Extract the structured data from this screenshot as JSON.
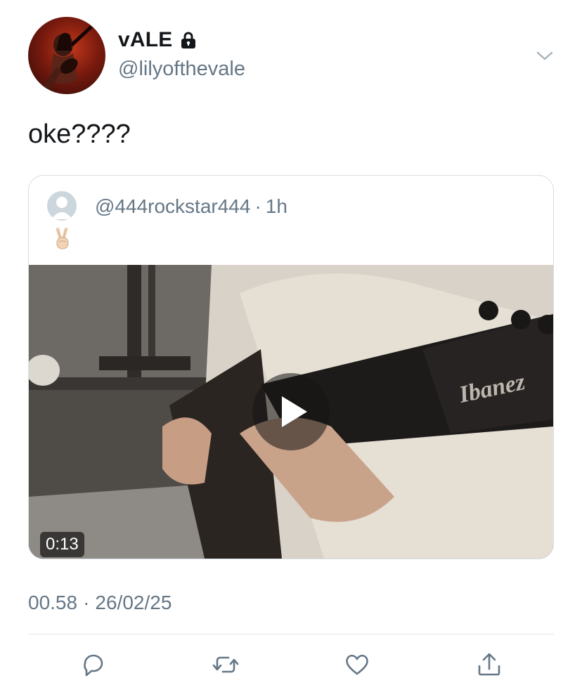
{
  "author": {
    "display_name": "vALE",
    "handle": "@lilyofthevale"
  },
  "tweet": {
    "text": "oke????"
  },
  "quoted_tweet": {
    "handle": "@444rockstar444",
    "separator": "·",
    "time": "1h",
    "text": "✌🏻",
    "video": {
      "duration": "0:13",
      "guitar_brand_text": "Ibanez"
    }
  },
  "meta": {
    "time": "00.58",
    "separator": "·",
    "date": "26/02/25"
  },
  "icons": {
    "lock": "lock-icon",
    "caret": "chevron-down-icon",
    "reply": "reply-icon",
    "retweet": "retweet-icon",
    "like": "heart-icon",
    "share": "share-icon",
    "play": "play-icon"
  },
  "colors": {
    "text_primary": "#14171a",
    "text_secondary": "#657786",
    "icon": "#657786",
    "border": "#d8dde2"
  }
}
